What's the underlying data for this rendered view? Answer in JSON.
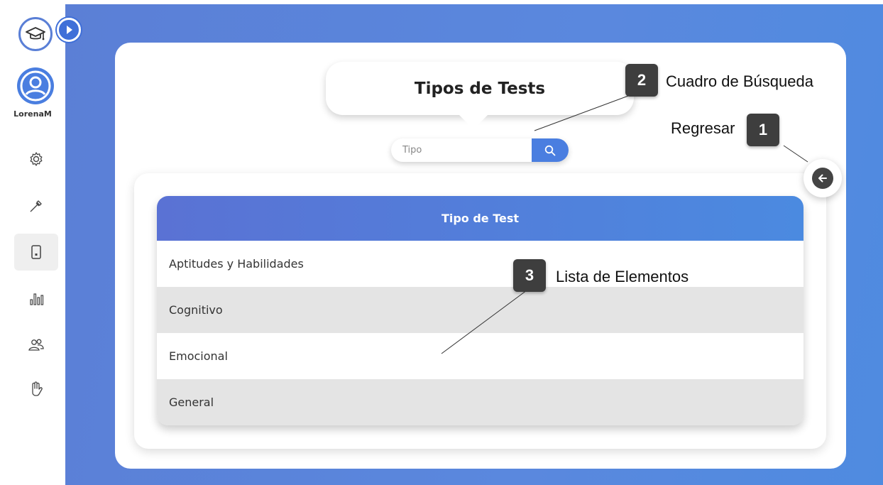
{
  "sidebar": {
    "username": "LorenaM",
    "items": [
      {
        "icon": "gear-icon"
      },
      {
        "icon": "dropper-icon"
      },
      {
        "icon": "tablet-icon"
      },
      {
        "icon": "bar-chart-icon"
      },
      {
        "icon": "users-icon"
      },
      {
        "icon": "hand-icon"
      }
    ]
  },
  "header": {
    "title": "Tipos de Tests"
  },
  "search": {
    "placeholder": "Tipo"
  },
  "table": {
    "header": "Tipo de Test",
    "rows": [
      "Aptitudes y Habilidades",
      "Cognitivo",
      "Emocional",
      "General"
    ]
  },
  "callouts": [
    {
      "number": "1",
      "text": "Regresar"
    },
    {
      "number": "2",
      "text": "Cuadro de Búsqueda"
    },
    {
      "number": "3",
      "text": "Lista de Elementos"
    }
  ],
  "colors": {
    "accent": "#4a7ee0",
    "background_gradient_start": "#5b7fd6",
    "callout_box": "#3e3e3e"
  }
}
